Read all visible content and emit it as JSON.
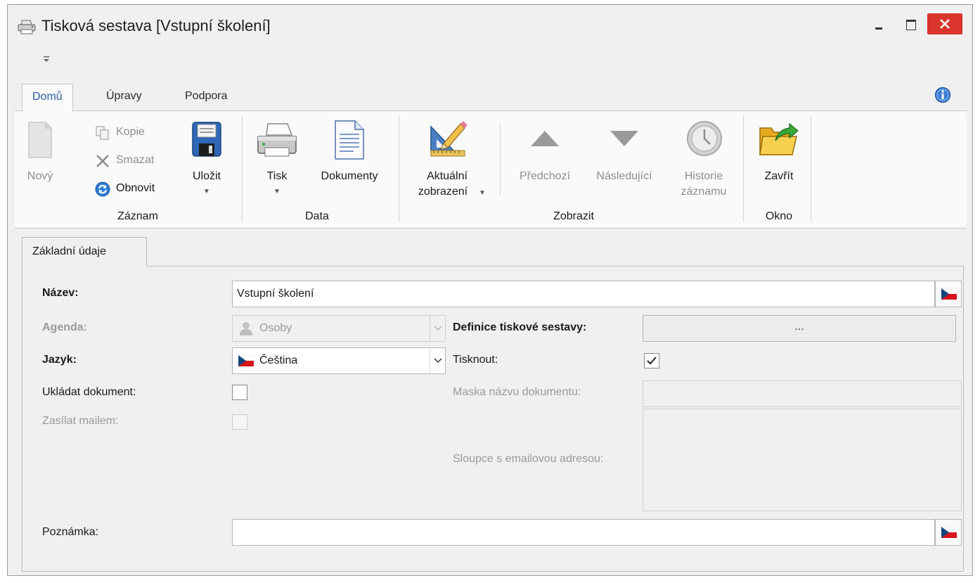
{
  "window": {
    "title": "Tisková sestava [Vstupní školení]"
  },
  "ribbon": {
    "tabs": [
      {
        "label": "Domů",
        "active": true
      },
      {
        "label": "Úpravy",
        "active": false
      },
      {
        "label": "Podpora",
        "active": false
      }
    ],
    "groups": {
      "record": {
        "label": "Záznam",
        "new": "Nový",
        "copy": "Kopie",
        "delete": "Smazat",
        "refresh": "Obnovit",
        "save": "Uložit"
      },
      "data": {
        "label": "Data",
        "print": "Tisk",
        "documents": "Dokumenty"
      },
      "view": {
        "label": "Zobrazit",
        "current_view_line1": "Aktuální",
        "current_view_line2": "zobrazení",
        "previous": "Předchozí",
        "next": "Následující",
        "history_line1": "Historie",
        "history_line2": "záznamu"
      },
      "window": {
        "label": "Okno",
        "close": "Zavřít"
      }
    }
  },
  "form": {
    "tab_label": "Základní údaje",
    "name": {
      "label": "Název:",
      "value": "Vstupní školení"
    },
    "agenda": {
      "label": "Agenda:",
      "value": "Osoby"
    },
    "definition": {
      "label": "Definice tiskové sestavy:",
      "button": "..."
    },
    "language": {
      "label": "Jazyk:",
      "value": "Čeština"
    },
    "print": {
      "label": "Tisknout:",
      "checked": true
    },
    "save_document": {
      "label": "Ukládat dokument:",
      "checked": false
    },
    "doc_name_mask": {
      "label": "Maska názvu dokumentu:",
      "value": ""
    },
    "send_mail": {
      "label": "Zasílat mailem:",
      "checked": false
    },
    "email_columns": {
      "label": "Sloupce s emailovou adresou:",
      "value": ""
    },
    "note": {
      "label": "Poznámka:",
      "value": ""
    }
  },
  "colors": {
    "accent": "#2a5fa8",
    "close_button": "#d9352c",
    "disabled_text": "#9a9a9a"
  }
}
